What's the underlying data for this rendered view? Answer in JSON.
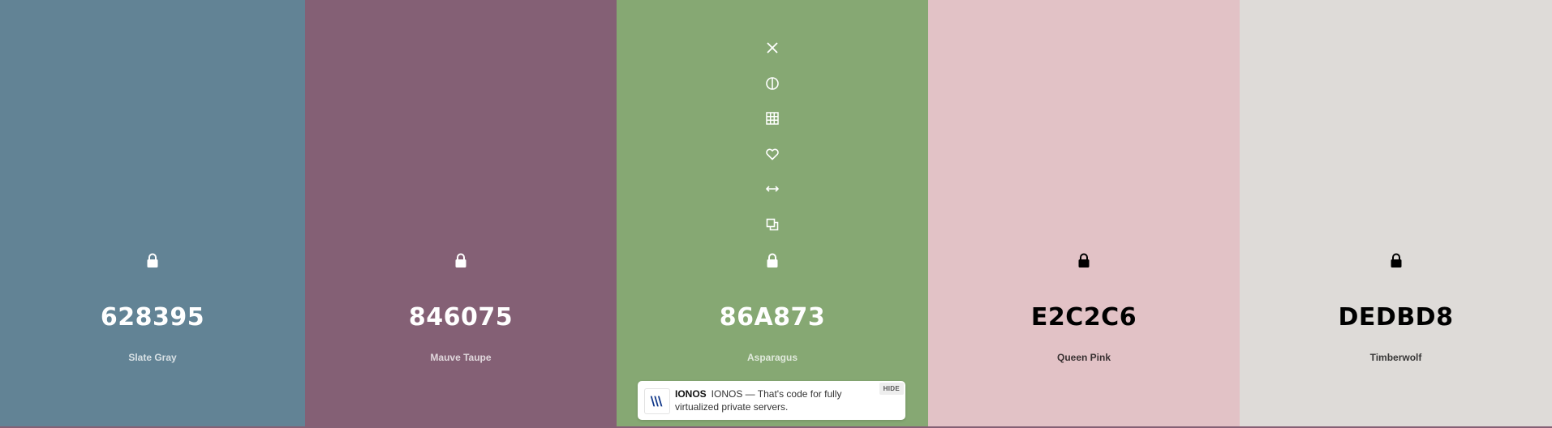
{
  "palette": {
    "colors": [
      {
        "hex": "628395",
        "name": "Slate Gray",
        "bg": "#628395",
        "fg": "#ffffff",
        "locked": true
      },
      {
        "hex": "846075",
        "name": "Mauve Taupe",
        "bg": "#846075",
        "fg": "#ffffff",
        "locked": true
      },
      {
        "hex": "86A873",
        "name": "Asparagus",
        "bg": "#86A873",
        "fg": "#ffffff",
        "locked": true
      },
      {
        "hex": "E2C2C6",
        "name": "Queen Pink",
        "bg": "#E2C2C6",
        "fg": "#000000",
        "locked": true
      },
      {
        "hex": "DEDBD8",
        "name": "Timberwolf",
        "bg": "#DEDBD8",
        "fg": "#000000",
        "locked": true
      }
    ]
  },
  "toolbar": {
    "icons": [
      "close-icon",
      "contrast-icon",
      "grid-icon",
      "heart-icon",
      "drag-arrows-icon",
      "copy-icon",
      "lock-icon"
    ]
  },
  "ad": {
    "brand": "IONOS",
    "text": "IONOS — That's code for fully virtualized private servers.",
    "hide_label": "HIDE"
  }
}
